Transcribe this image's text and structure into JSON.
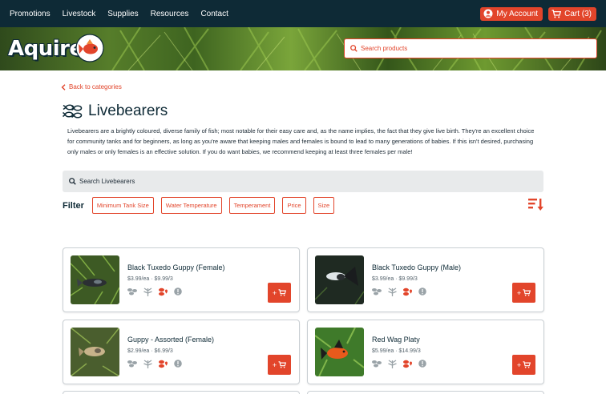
{
  "nav": {
    "items": [
      {
        "label": "Promotions"
      },
      {
        "label": "Livestock"
      },
      {
        "label": "Supplies"
      },
      {
        "label": "Resources"
      },
      {
        "label": "Contact"
      }
    ],
    "account_label": "My Account",
    "cart_label": "Cart (3)"
  },
  "brand": {
    "logo_text": "Aquire"
  },
  "search": {
    "placeholder": "Search products"
  },
  "category": {
    "back_label": "Back to categories",
    "title": "Livebearers",
    "description": "Livebearers are a brightly coloured, diverse family of fish; most notable for their easy care and, as the name implies, the fact that they give live birth. They're an excellent choice for community tanks and for beginners, as long as you're aware that keeping males and females is bound to lead to many generations of babies. If this isn't desired, purchasing only males or only females is an effective solution. If you do want babies, we recommend keeping at least three females per male!",
    "search_placeholder": "Search Livebearers"
  },
  "filters": {
    "label": "Filter",
    "chips": [
      {
        "label": "Minimum Tank Size"
      },
      {
        "label": "Water Temperature"
      },
      {
        "label": "Temperament"
      },
      {
        "label": "Price"
      },
      {
        "label": "Size"
      }
    ]
  },
  "products": [
    {
      "name": "Black Tuxedo Guppy (Female)",
      "price": "$3.99/ea · $9.99/3",
      "add_label": "+"
    },
    {
      "name": "Black Tuxedo Guppy (Male)",
      "price": "$3.99/ea · $9.99/3",
      "add_label": "+"
    },
    {
      "name": "Guppy - Assorted (Female)",
      "price": "$2.99/ea · $6.99/3",
      "add_label": "+"
    },
    {
      "name": "Red Wag Platy",
      "price": "$5.99/ea · $14.99/3",
      "add_label": "+"
    }
  ],
  "colors": {
    "nav_bg": "#0e2a36",
    "accent": "#e2452b",
    "text": "#1d2b36"
  },
  "icons": [
    "user-icon",
    "cart-icon",
    "search-icon",
    "chevron-left-icon",
    "fish-cluster-icon",
    "sort-descending-icon",
    "community-icon",
    "plant-icon",
    "compatibility-icon",
    "info-icon"
  ]
}
